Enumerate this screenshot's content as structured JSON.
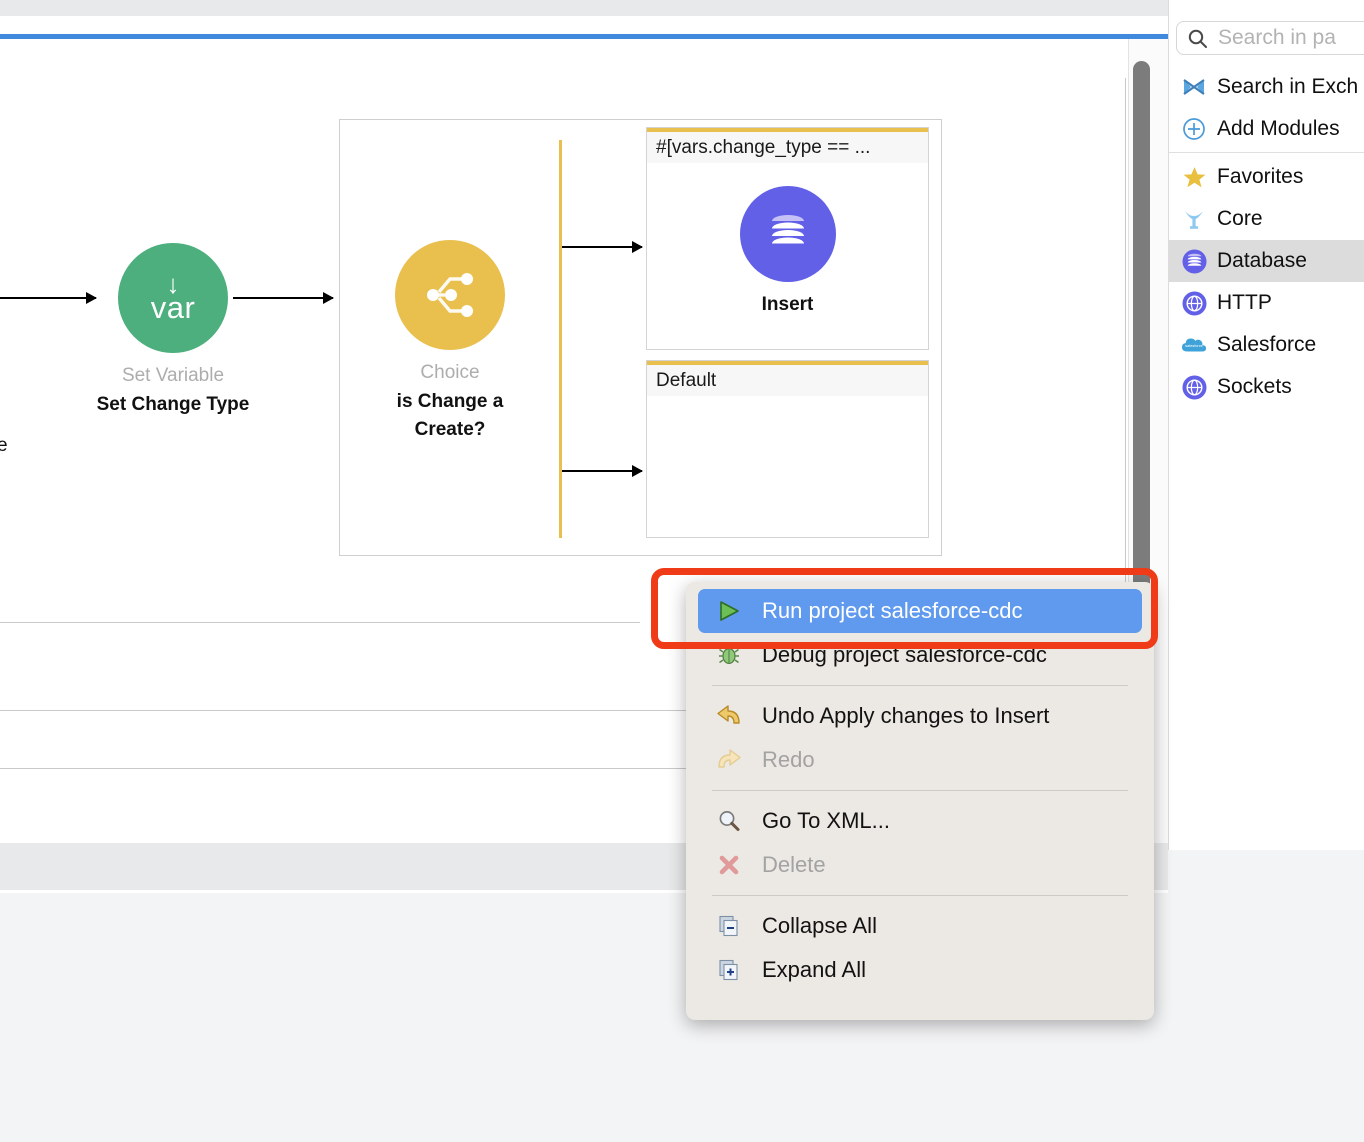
{
  "canvas": {
    "incoming_edge_label_cut": "e",
    "nodes": [
      {
        "id": "set-variable",
        "type_label": "Set Variable",
        "name": "Set Change Type",
        "glyph": "var",
        "icon": "arrow-down-var-icon",
        "color": "#4caf7d"
      },
      {
        "id": "choice",
        "type_label": "Choice",
        "name_line1": "is Change a",
        "name_line2": "Create?",
        "icon": "choice-branch-icon",
        "color": "#e9bf4e"
      }
    ],
    "routes": [
      {
        "id": "when-route",
        "header": "#[vars.change_type == ...",
        "component_name": "Insert",
        "component_icon": "database-icon",
        "component_color": "#6360e8"
      },
      {
        "id": "default-route",
        "header": "Default",
        "component_name": "",
        "component_icon": "",
        "component_color": ""
      }
    ]
  },
  "palette": {
    "search": {
      "placeholder": "Search in pa",
      "icon": "search-icon"
    },
    "groups": [
      {
        "items": [
          {
            "label": "Search in Exch",
            "icon": "exchange-icon",
            "selected": false
          },
          {
            "label": "Add Modules",
            "icon": "plus-circle-icon",
            "selected": false
          }
        ]
      },
      {
        "items": [
          {
            "label": "Favorites",
            "icon": "star-icon",
            "selected": false
          },
          {
            "label": "Core",
            "icon": "core-icon",
            "selected": false
          },
          {
            "label": "Database",
            "icon": "database-icon",
            "selected": true
          },
          {
            "label": "HTTP",
            "icon": "globe-icon",
            "selected": false
          },
          {
            "label": "Salesforce",
            "icon": "salesforce-cloud-icon",
            "selected": false
          },
          {
            "label": "Sockets",
            "icon": "globe-icon",
            "selected": false
          }
        ]
      }
    ]
  },
  "context_menu": {
    "groups": [
      {
        "items": [
          {
            "label": "Run project salesforce-cdc",
            "icon": "run-play-icon",
            "state": "highlighted"
          },
          {
            "label": "Debug project salesforce-cdc",
            "icon": "debug-bug-icon",
            "state": "normal"
          }
        ]
      },
      {
        "items": [
          {
            "label": "Undo Apply changes to Insert",
            "icon": "undo-arrow-icon",
            "state": "normal"
          },
          {
            "label": "Redo",
            "icon": "redo-arrow-icon",
            "state": "disabled"
          }
        ]
      },
      {
        "items": [
          {
            "label": "Go To XML...",
            "icon": "magnifier-icon",
            "state": "normal"
          },
          {
            "label": "Delete",
            "icon": "delete-x-icon",
            "state": "disabled"
          }
        ]
      },
      {
        "items": [
          {
            "label": "Collapse All",
            "icon": "collapse-all-icon",
            "state": "normal"
          },
          {
            "label": "Expand All",
            "icon": "expand-all-icon",
            "state": "normal"
          }
        ]
      }
    ]
  },
  "annotation": {
    "shape": "rounded-rectangle",
    "color": "#ef3b18",
    "targets": "run-project-menu-item"
  },
  "colors": {
    "accent_blue": "#4189dd",
    "highlight_blue": "#5f9aef",
    "choice_yellow": "#e9bf4e",
    "set_variable_green": "#4caf7d",
    "database_purple": "#6360e8",
    "annotation_red": "#ef3b18"
  }
}
